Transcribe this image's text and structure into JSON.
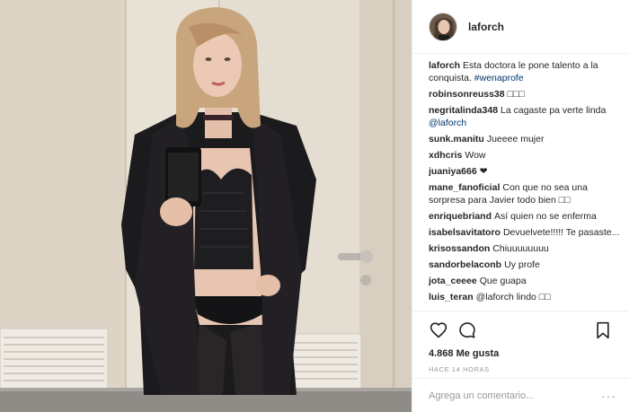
{
  "photo": {
    "alt": "mirror selfie"
  },
  "post": {
    "username": "laforch",
    "likes_text": "4.868 Me gusta",
    "time_text": "HACE 14 HORAS",
    "comment_placeholder": "Agrega un comentario...",
    "more_label": "···"
  },
  "comments": [
    {
      "author": "laforch",
      "text": "Esta doctora le pone talento a la conquista. ",
      "link": "#wenaprofe"
    },
    {
      "author": "robinsonreuss38",
      "text": "□□□"
    },
    {
      "author": "negritalinda348",
      "text": "La cagaste pa verte linda ",
      "link": "@laforch"
    },
    {
      "author": "sunk.manitu",
      "text": "Jueeee mujer"
    },
    {
      "author": "xdhcris",
      "text": "Wow"
    },
    {
      "author": "juaniya666",
      "text": "❤"
    },
    {
      "author": "mane_fanoficial",
      "text": "Con que no sea una sorpresa para Javier todo bien □□"
    },
    {
      "author": "enriquebriand",
      "text": "Así quien no se enferma"
    },
    {
      "author": "isabelsavitatoro",
      "text": "Devuelvete!!!!! Te pasaste..."
    },
    {
      "author": "krisossandon",
      "text": "Chiuuuuuuuu"
    },
    {
      "author": "sandorbelaconb",
      "text": "Uy profe"
    },
    {
      "author": "jota_ceeee",
      "text": "Que guapa"
    },
    {
      "author": "luis_teran",
      "text": "@laforch lindo □□"
    }
  ],
  "icons": {
    "like": "heart-icon",
    "comment": "comment-icon",
    "save": "bookmark-icon"
  },
  "colors": {
    "link": "#003569",
    "text": "#262626",
    "muted": "#999999",
    "border": "#efefef"
  }
}
